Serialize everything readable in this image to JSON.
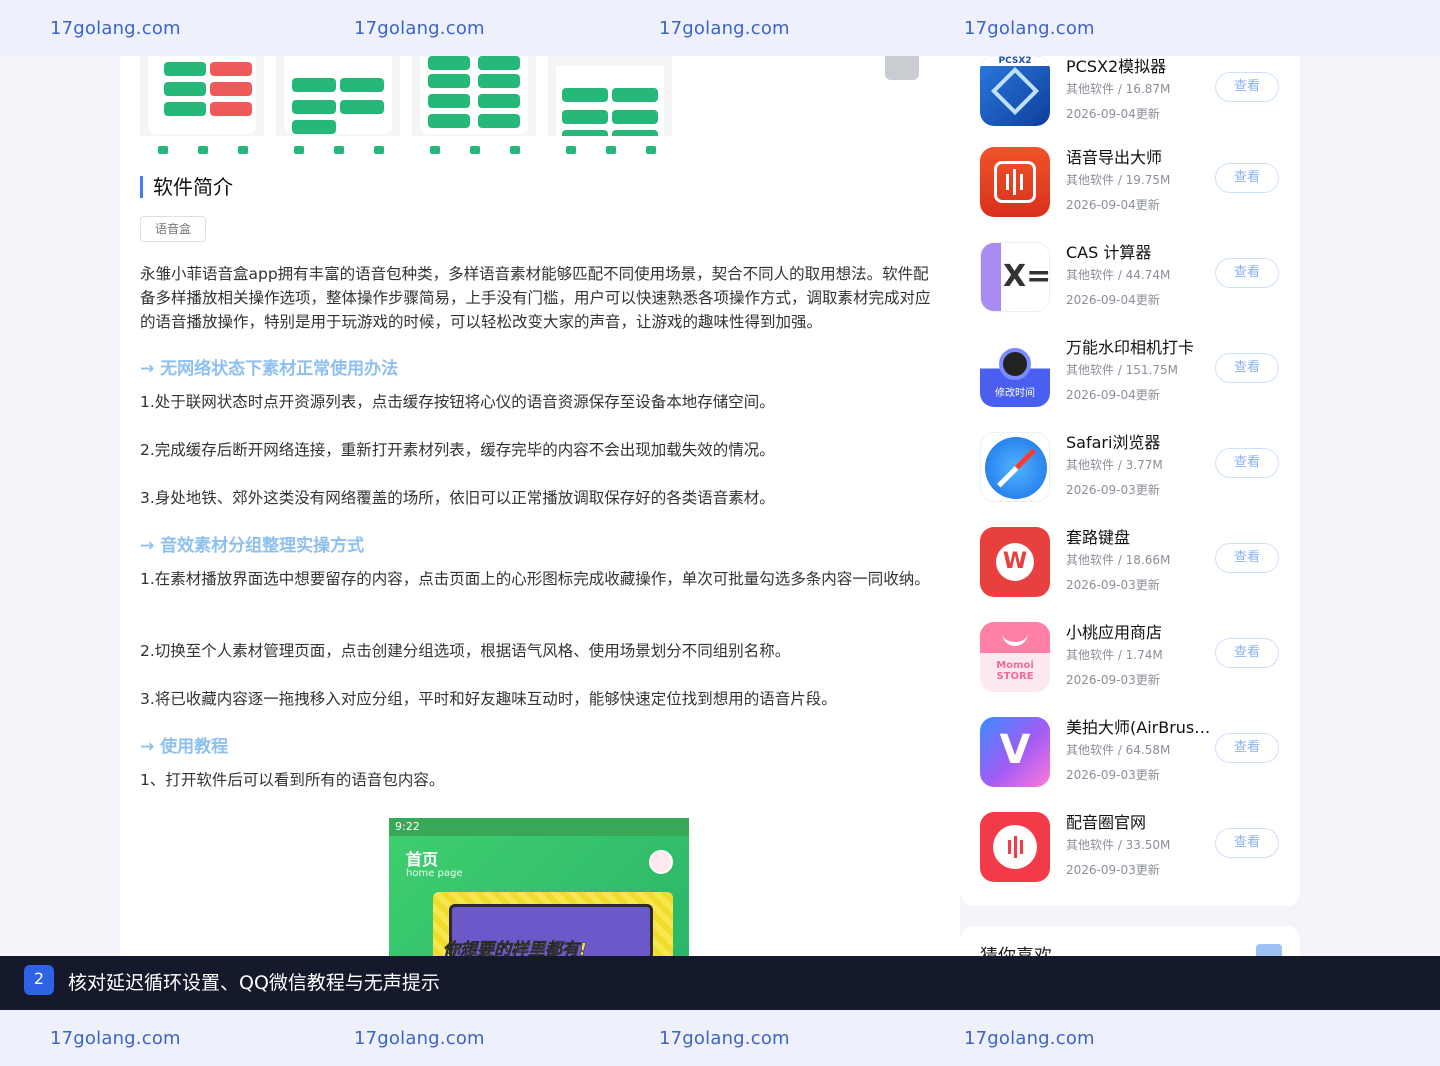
{
  "watermark": {
    "text": "17golang.com"
  },
  "article": {
    "section_title": "软件简介",
    "tag": "语音盒",
    "intro": "永雏小菲语音盒app拥有丰富的语音包种类，多样语音素材能够匹配不同使用场景，契合不同人的取用想法。软件配备多样播放相关操作选项，整体操作步骤简易，上手没有门槛，用户可以快速熟悉各项操作方式，调取素材完成对应的语音播放操作，特别是用于玩游戏的时候，可以轻松改变大家的声音，让游戏的趣味性得到加强。",
    "h1": "→ 无网络状态下素材正常使用办法",
    "h1_items": [
      "1.处于联网状态时点开资源列表，点击缓存按钮将心仪的语音资源保存至设备本地存储空间。",
      "2.完成缓存后断开网络连接，重新打开素材列表，缓存完毕的内容不会出现加载失效的情况。",
      "3.身处地铁、郊外这类没有网络覆盖的场所，依旧可以正常播放调取保存好的各类语音素材。"
    ],
    "h2": "→ 音效素材分组整理实操方式",
    "h2_items": [
      "1.在素材播放界面选中想要留存的内容，点击页面上的心形图标完成收藏操作，单次可批量勾选多条内容一同收纳。",
      "2.切换至个人素材管理页面，点击创建分组选项，根据语气风格、使用场景划分不同组别名称。",
      "3.将已收藏内容逐一拖拽移入对应分组，平时和好友趣味互动时，能够快速定位找到想用的语音片段。"
    ],
    "h3": "→ 使用教程",
    "h3_items": [
      "1、打开软件后可以看到所有的语音包内容。"
    ],
    "phone": {
      "time": "9:22",
      "title": "首页",
      "subtitle": "home page",
      "banner_text": "你想要的样里都有!"
    }
  },
  "sidebar": {
    "view_label": "查看",
    "apps": [
      {
        "name": "PCSX2模拟器",
        "meta": "其他软件 / 16.87M",
        "date": "2026-09-04更新",
        "icon": "pcsx2-icon",
        "icon_text": "PCSX2"
      },
      {
        "name": "语音导出大师",
        "meta": "其他软件 / 19.75M",
        "date": "2026-09-04更新",
        "icon": "voice-export-icon",
        "icon_text": ""
      },
      {
        "name": "CAS 计算器",
        "meta": "其他软件 / 44.74M",
        "date": "2026-09-04更新",
        "icon": "cas-calculator-icon",
        "icon_text": "X="
      },
      {
        "name": "万能水印相机打卡",
        "meta": "其他软件 / 151.75M",
        "date": "2026-09-04更新",
        "icon": "watermark-camera-icon",
        "icon_text": "修改时间"
      },
      {
        "name": "Safari浏览器",
        "meta": "其他软件 / 3.77M",
        "date": "2026-09-03更新",
        "icon": "safari-compass-icon",
        "icon_text": ""
      },
      {
        "name": "套路键盘",
        "meta": "其他软件 / 18.66M",
        "date": "2026-09-03更新",
        "icon": "keyboard-w-icon",
        "icon_text": "W"
      },
      {
        "name": "小桃应用商店",
        "meta": "其他软件 / 1.74M",
        "date": "2026-09-03更新",
        "icon": "momoi-store-icon",
        "icon_text": "Momoi STORE"
      },
      {
        "name": "美拍大师(AirBrush…",
        "meta": "其他软件 / 64.58M",
        "date": "2026-09-03更新",
        "icon": "airbrush-v-icon",
        "icon_text": "V"
      },
      {
        "name": "配音圈官网",
        "meta": "其他软件 / 33.50M",
        "date": "2026-09-03更新",
        "icon": "dubbing-circle-icon",
        "icon_text": ""
      }
    ],
    "guess_title": "猜你喜欢"
  },
  "banner": {
    "number": "2",
    "text": "核对延迟循环设置、QQ微信教程与无声提示"
  }
}
